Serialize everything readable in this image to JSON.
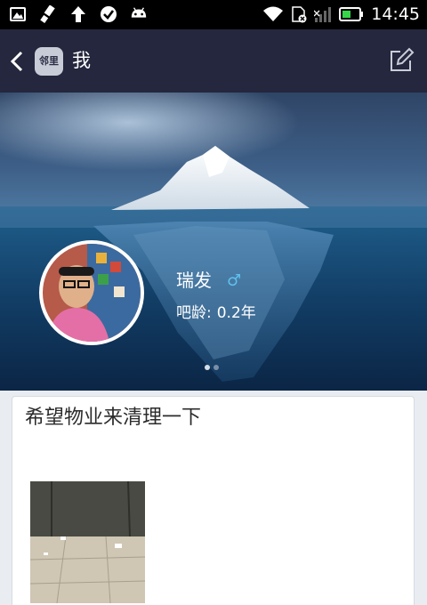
{
  "status_bar": {
    "time": "14:45",
    "icons_left": [
      "image-icon",
      "brush-icon",
      "upload-icon",
      "check-icon",
      "android-icon"
    ],
    "icons_right": [
      "wifi-icon",
      "sim-icon",
      "signal-icon",
      "battery-icon"
    ],
    "battery_level": 0.5
  },
  "nav": {
    "logo_text": "邻里",
    "title": "我"
  },
  "profile": {
    "name": "瑞发",
    "gender_symbol": "♂",
    "age_label": "吧龄:",
    "age_value": "0.2年",
    "carousel_pages": 2,
    "carousel_active": 0
  },
  "post": {
    "title": "希望物业来清理一下"
  },
  "colors": {
    "nav_bg": "#24273d",
    "gender_blue": "#5ec1ee",
    "page_bg": "#e9ecf1"
  }
}
